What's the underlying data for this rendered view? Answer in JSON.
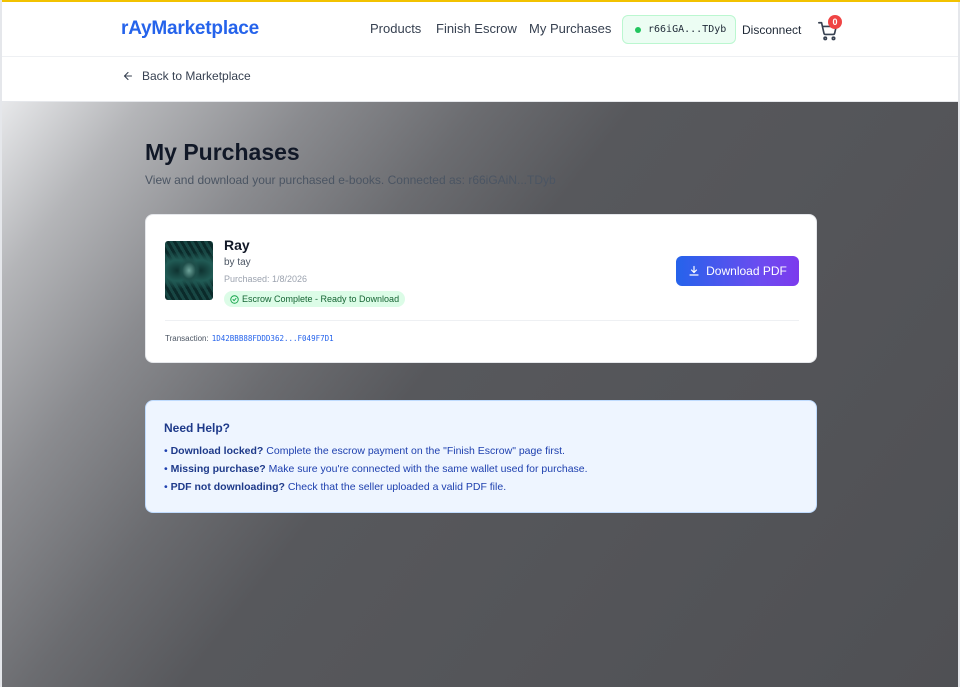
{
  "header": {
    "brand": "rAyMarketplace",
    "nav": [
      "Products",
      "Finish Escrow",
      "My Purchases"
    ],
    "wallet_address": "r66iGA...TDyb",
    "disconnect_label": "Disconnect",
    "cart_count": "0"
  },
  "subbar": {
    "back_label": "Back to Marketplace"
  },
  "page": {
    "title": "My Purchases",
    "subtitle": "View and download your purchased e-books. Connected as: r66iGAiN...TDyb"
  },
  "purchases": [
    {
      "title": "Ray",
      "author": "by tay",
      "purchased": "Purchased: 1/8/2026",
      "status": "Escrow Complete - Ready to Download",
      "download_label": "Download PDF",
      "transaction_label": "Transaction:",
      "transaction_hash": "1D42BBB88FDDD362...F049F7D1"
    }
  ],
  "help": {
    "title": "Need Help?",
    "items": [
      {
        "bold": "Download locked?",
        "text": " Complete the escrow payment on the \"Finish Escrow\" page first."
      },
      {
        "bold": "Missing purchase?",
        "text": " Make sure you're connected with the same wallet used for purchase."
      },
      {
        "bold": "PDF not downloading?",
        "text": " Check that the seller uploaded a valid PDF file."
      }
    ]
  },
  "colors": {
    "brand": "#2563eb",
    "status_green": "#166534",
    "help_bg": "#eef5ff"
  }
}
